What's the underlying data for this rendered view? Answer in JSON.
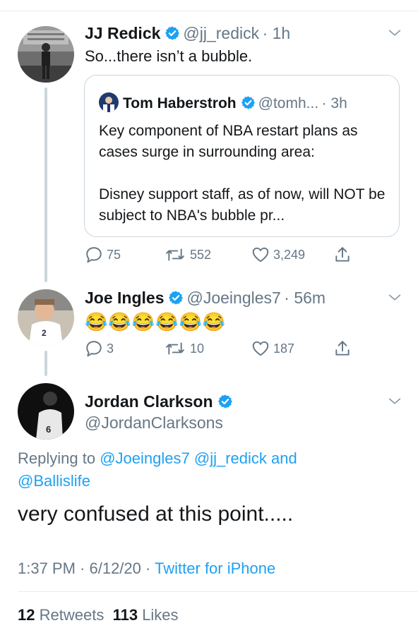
{
  "tweet1": {
    "name": "JJ Redick",
    "handle": "@jj_redick",
    "time": "· 1h",
    "text": "So...there isn’t a bubble.",
    "quote": {
      "name": "Tom Haberstroh",
      "handle": "@tomh...",
      "time": "· 3h",
      "para1": "Key component of NBA restart plans as cases surge in surrounding area:",
      "para2": "Disney support staff, as of now, will NOT be subject to NBA's bubble pr..."
    },
    "replies": "75",
    "retweets": "552",
    "likes": "3,249"
  },
  "tweet2": {
    "name": "Joe Ingles",
    "handle": "@Joeingles7",
    "time": "· 56m",
    "text": "😂😂😂😂😂😂",
    "replies": "3",
    "retweets": "10",
    "likes": "187",
    "jersey": "2"
  },
  "tweet3": {
    "name": "Jordan Clarkson",
    "handle": "@JordanClarksons",
    "jersey": "6",
    "replying_prefix": "Replying to",
    "mention1": "@Joeingles7",
    "mention2": "@jj_redick",
    "and": "and",
    "mention3": "@Ballislife",
    "text": "very confused at this point.....",
    "timestamp": "1:37 PM · 6/12/20 ·",
    "source": "Twitter for iPhone",
    "retweet_count": "12",
    "retweet_label": "Retweets",
    "like_count": "113",
    "like_label": "Likes"
  },
  "colors": {
    "accent": "#1da1f2",
    "secondary_text": "#657786",
    "border": "#ccd6dd"
  },
  "icons": [
    "verified-badge-icon",
    "chevron-down-icon",
    "reply-icon",
    "retweet-icon",
    "like-icon",
    "share-icon"
  ]
}
